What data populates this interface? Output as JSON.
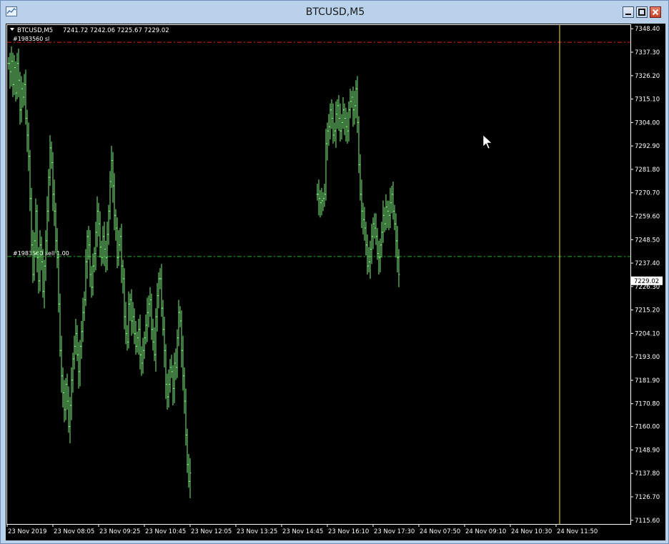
{
  "window": {
    "title": "BTCUSD,M5",
    "controls": {
      "minimize": "minimize",
      "maximize": "maximize",
      "close": "close"
    }
  },
  "header": {
    "symbol": "BTCUSD,M5",
    "ohlc": "7241.72 7242.06 7225.67 7229.02"
  },
  "order_lines": {
    "stop_loss": {
      "label": "#1983560 sl",
      "price": 7342.0,
      "color": "#e02020"
    },
    "open": {
      "label": "#1983560 sell 1.00",
      "price": 7240.5,
      "color": "#20b030"
    }
  },
  "current_price": {
    "value": 7229.02,
    "label": "7229.02"
  },
  "cursor_line": {
    "at_label": "24 Nov 11:50",
    "color": "#f5e45a"
  },
  "colors": {
    "candle": "#7ef07e",
    "background": "#000000",
    "axis": "#ffffff"
  },
  "chart_data": {
    "type": "line",
    "y_axis_labels": [
      "7348.40",
      "7337.30",
      "7326.20",
      "7315.10",
      "7304.00",
      "7292.90",
      "7281.80",
      "7270.70",
      "7259.60",
      "7248.50",
      "7237.40",
      "7226.30",
      "7215.20",
      "7204.10",
      "7193.00",
      "7181.90",
      "7170.80",
      "7160.00",
      "7148.90",
      "7137.80",
      "7126.70",
      "7115.60"
    ],
    "y_axis_values": [
      7348.4,
      7337.3,
      7326.2,
      7315.1,
      7304.0,
      7292.9,
      7281.8,
      7270.7,
      7259.6,
      7248.5,
      7237.4,
      7226.3,
      7215.2,
      7204.1,
      7193.0,
      7181.9,
      7170.8,
      7160.0,
      7148.9,
      7137.8,
      7126.7,
      7115.6
    ],
    "ylim": [
      7114.5,
      7349.5
    ],
    "x_axis_labels": [
      "23 Nov 2019",
      "23 Nov 08:05",
      "23 Nov 09:25",
      "23 Nov 10:45",
      "23 Nov 12:05",
      "23 Nov 13:25",
      "23 Nov 14:45",
      "23 Nov 16:10",
      "23 Nov 17:30",
      "24 Nov 07:50",
      "24 Nov 09:10",
      "24 Nov 10:30",
      "24 Nov 11:50"
    ],
    "segments": [
      {
        "start": 0,
        "closes": [
          7332,
          7328,
          7333,
          7322,
          7330,
          7318,
          7332,
          7324,
          7310,
          7320,
          7316,
          7322,
          7306,
          7298,
          7288,
          7268,
          7246,
          7232,
          7248,
          7262,
          7240,
          7229,
          7246,
          7238,
          7224,
          7236,
          7248,
          7262,
          7278,
          7292,
          7285,
          7270,
          7262,
          7248,
          7240,
          7218,
          7196,
          7184,
          7176,
          7168,
          7180,
          7172,
          7160,
          7170,
          7182,
          7192,
          7198,
          7204,
          7194,
          7186,
          7198,
          7205,
          7214,
          7220,
          7238,
          7250,
          7246,
          7232,
          7226,
          7236,
          7242,
          7252,
          7262,
          7256,
          7245,
          7240,
          7250,
          7244,
          7240,
          7251,
          7262,
          7276,
          7286,
          7274,
          7260,
          7254,
          7240,
          7246,
          7250,
          7236,
          7230,
          7212,
          7204,
          7200,
          7218,
          7220,
          7210,
          7212,
          7204,
          7198,
          7202,
          7206,
          7194,
          7190,
          7196,
          7202,
          7208,
          7214,
          7218,
          7220,
          7206,
          7200,
          7194,
          7212,
          7222,
          7230,
          7230,
          7216,
          7206,
          7196,
          7180,
          7174,
          7180,
          7188,
          7186,
          7178,
          7190,
          7188,
          7202,
          7214,
          7210,
          7196,
          7184,
          7172,
          7156,
          7142,
          7134,
          7138
        ]
      },
      {
        "start": 216,
        "closes": [
          7270,
          7268,
          7266,
          7267,
          7268,
          7270,
          7294,
          7300,
          7302,
          7310,
          7306,
          7298,
          7300,
          7308,
          7312,
          7306,
          7300,
          7304,
          7310,
          7306,
          7302,
          7300,
          7310,
          7314,
          7316,
          7310,
          7312,
          7320,
          7304,
          7284,
          7270,
          7262,
          7258,
          7254,
          7246,
          7236,
          7238,
          7244,
          7250,
          7256,
          7254,
          7250,
          7242,
          7240,
          7246,
          7252,
          7260,
          7256,
          7264,
          7262,
          7260,
          7266,
          7270,
          7262,
          7256,
          7248,
          7240,
          7232
        ]
      }
    ]
  }
}
